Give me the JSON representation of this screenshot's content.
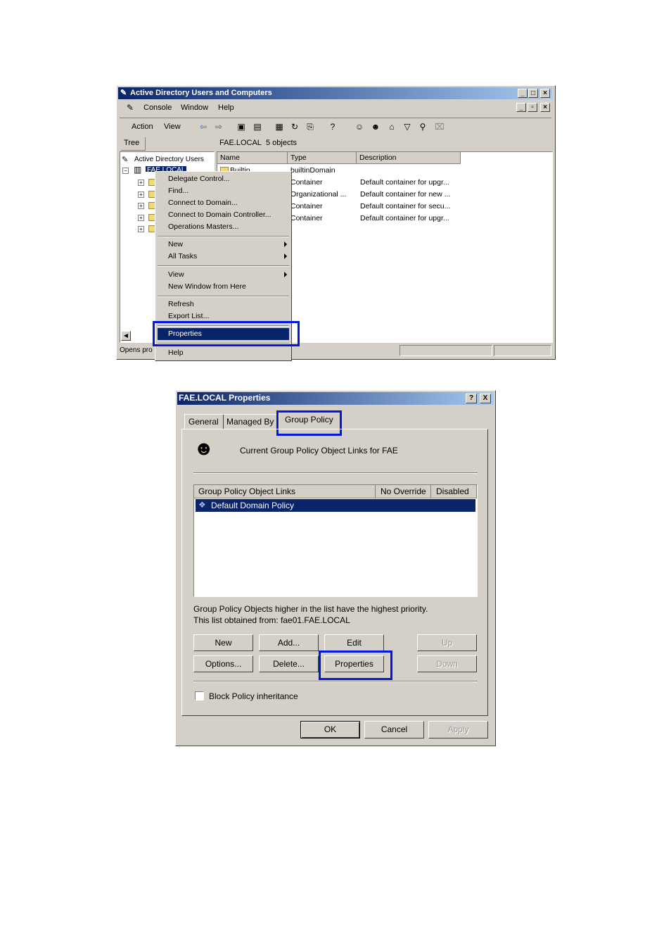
{
  "aduc": {
    "title": "Active Directory Users and Computers",
    "menubar": [
      "Console",
      "Window",
      "Help"
    ],
    "actionbar": [
      "Action",
      "View"
    ],
    "tree_tab": "Tree",
    "tree_root": "Active Directory Users",
    "tree_selected": "FAE.LOCAL",
    "right_header": "FAE.LOCAL",
    "object_count": "5 objects",
    "columns": [
      "Name",
      "Type",
      "Description"
    ],
    "rows": [
      {
        "name": "Builtin",
        "type": "builtinDomain",
        "desc": ""
      },
      {
        "name": "",
        "type": "Container",
        "desc": "Default container for upgr..."
      },
      {
        "name": "",
        "type": "Organizational ...",
        "desc": "Default container for new ..."
      },
      {
        "name": "",
        "type": "Container",
        "desc": "Default container for secu..."
      },
      {
        "name": "",
        "type": "Container",
        "desc": "Default container for upgr..."
      }
    ],
    "status": "Opens pro",
    "context_menu": {
      "items": [
        "Delegate Control...",
        "Find...",
        "Connect to Domain...",
        "Connect to Domain Controller...",
        "Operations Masters...",
        "New",
        "All Tasks",
        "View",
        "New Window from Here",
        "Refresh",
        "Export List...",
        "Properties",
        "Help"
      ]
    }
  },
  "dialog": {
    "title": "FAE.LOCAL Properties",
    "help_btn": "?",
    "close_btn": "X",
    "tabs": [
      "General",
      "Managed By",
      "Group Policy"
    ],
    "header_text": "Current Group Policy Object Links for FAE",
    "list_columns": [
      "Group Policy Object Links",
      "No Override",
      "Disabled"
    ],
    "list_items": [
      "Default Domain Policy"
    ],
    "info_line1": "Group Policy Objects higher in the list have the highest priority.",
    "info_line2": "This list obtained from: fae01.FAE.LOCAL",
    "buttons": {
      "new": "New",
      "add": "Add...",
      "edit": "Edit",
      "up": "Up",
      "options": "Options...",
      "delete": "Delete...",
      "properties": "Properties",
      "down": "Down"
    },
    "block_inheritance": "Block Policy inheritance",
    "block_inheritance_checked": false,
    "ok": "OK",
    "cancel": "Cancel",
    "apply": "Apply"
  }
}
